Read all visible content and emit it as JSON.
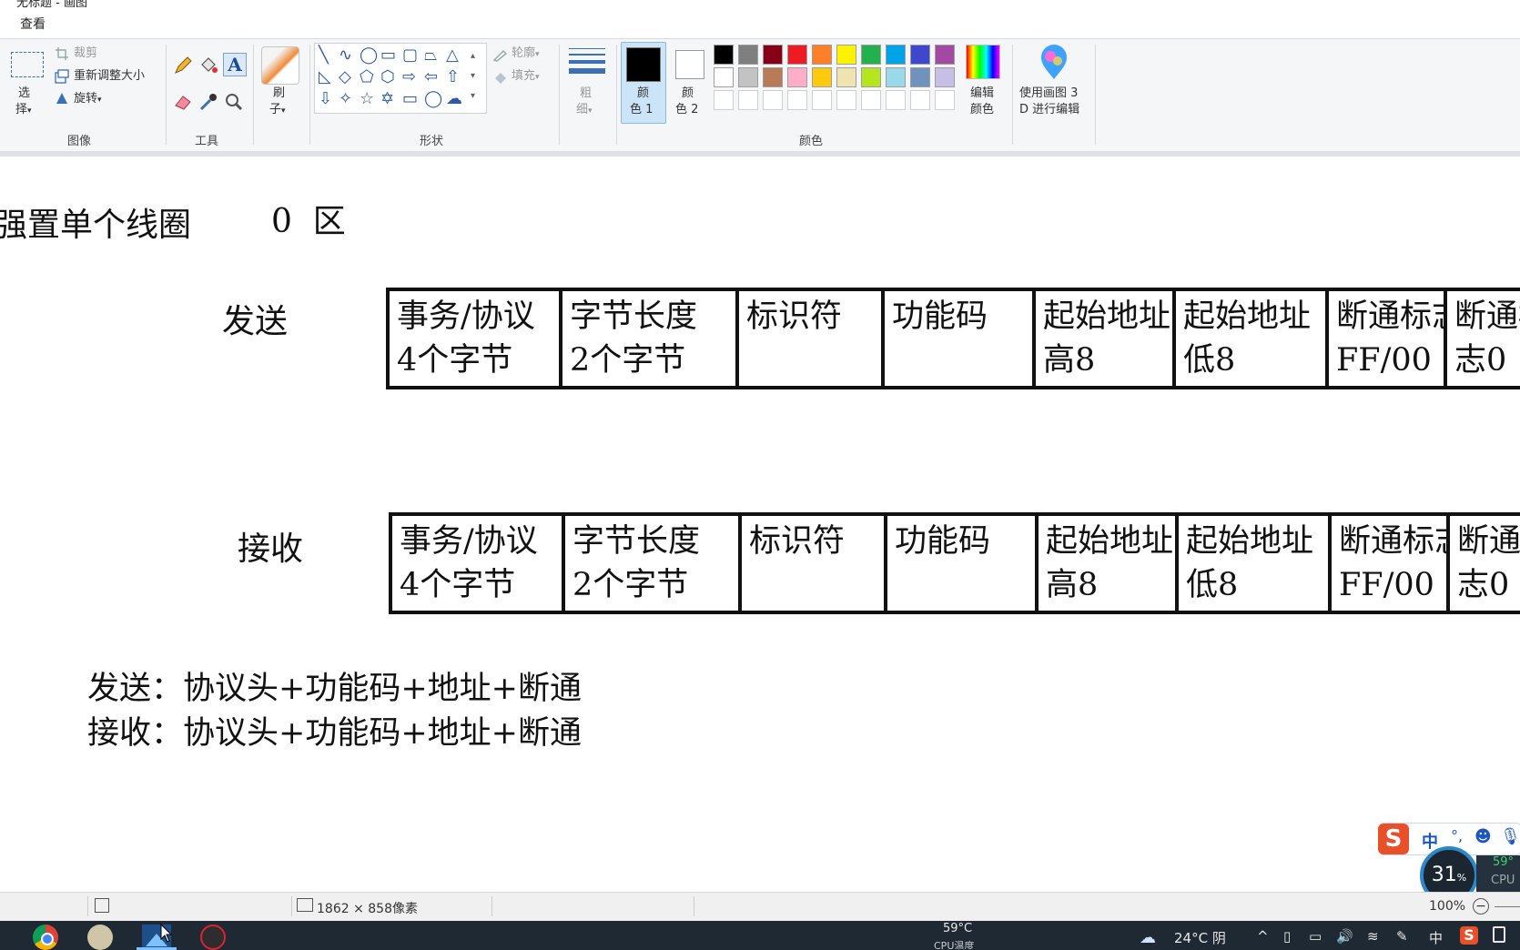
{
  "window": {
    "title": "无标题 - 画图"
  },
  "menu": {
    "view_tab": "查看"
  },
  "ribbon": {
    "image": {
      "select_line1": "选",
      "select_line2": "择",
      "crop": "裁剪",
      "resize": "重新调整大小",
      "rotate": "旋转",
      "group_label": "图像"
    },
    "tools": {
      "group_label": "工具"
    },
    "brushes": {
      "line1": "刷",
      "line2": "子"
    },
    "shapes": {
      "outline": "轮廓",
      "fill": "填充",
      "group_label": "形状"
    },
    "size": {
      "line1": "粗",
      "line2": "细"
    },
    "colors": {
      "color1_line1": "颜",
      "color1_line2": "色 1",
      "color2_line1": "颜",
      "color2_line2": "色 2",
      "edit_line1": "编辑",
      "edit_line2": "颜色",
      "group_label": "颜色",
      "palette_row1": [
        "#000000",
        "#7f7f7f",
        "#880015",
        "#ed1c24",
        "#ff7f27",
        "#fff200",
        "#22b14c",
        "#00a2e8",
        "#3f48cc",
        "#a349a4"
      ],
      "palette_row2": [
        "#ffffff",
        "#c3c3c3",
        "#b97a57",
        "#ffaec9",
        "#ffc90e",
        "#efe4b0",
        "#b5e61d",
        "#99d9ea",
        "#7092be",
        "#c8bfe7"
      ]
    },
    "paint3d": {
      "line1": "使用画图 3",
      "line2": "D 进行编辑"
    }
  },
  "canvas": {
    "heading": "强置单个线圈",
    "zone": "0  区",
    "send_label": "发送",
    "recv_label": "接收",
    "send_cells": [
      {
        "l1": "事务/协议",
        "l2": "4个字节"
      },
      {
        "l1": "字节长度",
        "l2": "2个字节"
      },
      {
        "l1": "标识符",
        "l2": ""
      },
      {
        "l1": "功能码",
        "l2": ""
      },
      {
        "l1": "起始地址",
        "l2": "高8"
      },
      {
        "l1": "起始地址",
        "l2": "低8"
      },
      {
        "l1": "断通标志",
        "l2": "FF/00"
      },
      {
        "l1": "断通标",
        "l2": "志0"
      }
    ],
    "recv_cells": [
      {
        "l1": "事务/协议",
        "l2": "4个字节"
      },
      {
        "l1": "字节长度",
        "l2": "2个字节"
      },
      {
        "l1": "标识符",
        "l2": ""
      },
      {
        "l1": "功能码",
        "l2": ""
      },
      {
        "l1": "起始地址",
        "l2": "高8"
      },
      {
        "l1": "起始地址",
        "l2": "低8"
      },
      {
        "l1": "断通标志",
        "l2": "FF/00"
      },
      {
        "l1": "断通标",
        "l2": "志0"
      }
    ],
    "summary_send": "发送：协议头+功能码+地址+断通",
    "summary_recv": "接收：协议头+功能码+地址+断通"
  },
  "statusbar": {
    "dimensions": "1862 × 858像素",
    "zoom": "100%"
  },
  "ime": {
    "mode": "中",
    "punct": "°,"
  },
  "cpu_widget": {
    "percent": "31",
    "unit": "%",
    "temp": "59°",
    "label": "CPU"
  },
  "taskbar": {
    "cpu_temp": "59°C",
    "cpu_temp_label": "CPU温度",
    "weather": "24°C 阴",
    "ime": "中"
  }
}
